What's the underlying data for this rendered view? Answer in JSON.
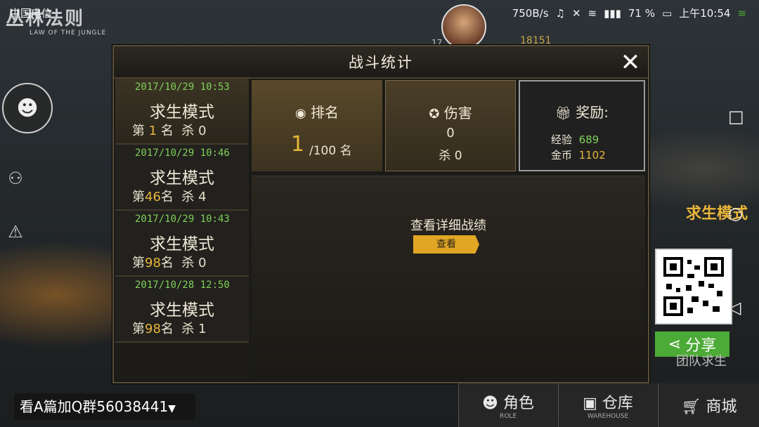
{
  "status_bar": {
    "carrier": "中国电信",
    "speed": "750B/s",
    "battery": "71 %",
    "time": "上午10:54"
  },
  "game_logo": {
    "title": "丛林法则",
    "subtitle": "LAW OF THE JUNGLE"
  },
  "top_info": {
    "level": "17",
    "coins": "18151"
  },
  "dialog": {
    "title": "战斗统计",
    "close_icon": "close-icon",
    "history": [
      {
        "datetime": "2017/10/29 10:53",
        "mode": "求生模式",
        "rank_prefix": "第",
        "rank": "1",
        "rank_suffix": "名",
        "kills_label": "杀",
        "kills": "0",
        "active": true
      },
      {
        "datetime": "2017/10/29 10:46",
        "mode": "求生模式",
        "rank_prefix": "第",
        "rank": "46",
        "rank_suffix": "名",
        "kills_label": "杀",
        "kills": "4",
        "active": false
      },
      {
        "datetime": "2017/10/29 10:43",
        "mode": "求生模式",
        "rank_prefix": "第",
        "rank": "98",
        "rank_suffix": "名",
        "kills_label": "杀",
        "kills": "0",
        "active": false
      },
      {
        "datetime": "2017/10/28 12:50",
        "mode": "求生模式",
        "rank_prefix": "第",
        "rank": "98",
        "rank_suffix": "名",
        "kills_label": "杀",
        "kills": "1",
        "active": false
      }
    ],
    "rank_card": {
      "icon": "rank-icon",
      "title": "排名",
      "value": "1",
      "total": "/100 名"
    },
    "damage_card": {
      "icon": "medal-icon",
      "title": "伤害",
      "value": "0",
      "kills_label": "杀",
      "kills": "0"
    },
    "reward_card": {
      "icon": "gift-icon",
      "title": "奖励:",
      "exp_label": "经验",
      "exp": "689",
      "gold_label": "金币",
      "gold": "1102"
    },
    "detail": {
      "text": "查看详细战绩",
      "button": "查看"
    }
  },
  "right_panel": {
    "mode_label": "求生模式",
    "share_label": "分享",
    "team_label": "团队求生"
  },
  "bottom": {
    "qq_tip": "看A篇加Q群56038441",
    "nav": [
      {
        "label": "角色",
        "sub": "ROLE",
        "icon": "person-icon"
      },
      {
        "label": "仓库",
        "sub": "WAREHOUSE",
        "icon": "box-icon"
      },
      {
        "label": "商城",
        "sub": "",
        "icon": "cart-icon"
      }
    ]
  },
  "colors": {
    "accent": "#e0a624",
    "green": "#7fd15a",
    "gold_num": "#e8b53a"
  }
}
